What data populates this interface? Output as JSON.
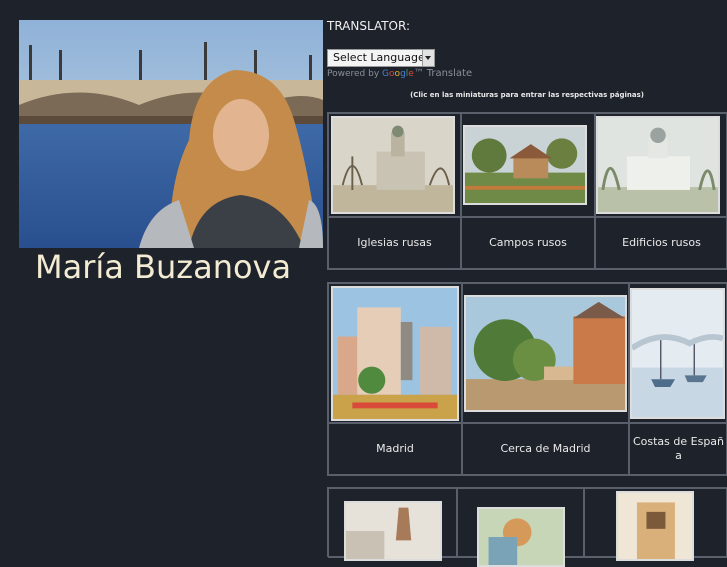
{
  "artist": {
    "name": "María Buzanova"
  },
  "translator": {
    "label": "TRANSLATOR:",
    "select_value": "Select Language",
    "powered_by": "Powered by",
    "google_letters": [
      "G",
      "o",
      "o",
      "g",
      "l",
      "e"
    ],
    "tm": "™",
    "translate": "Translate"
  },
  "hint": "(Clic en las miniaturas para entrar las respectivas páginas)",
  "galleries": {
    "row1": [
      {
        "label": "Iglesias rusas"
      },
      {
        "label": "Campos rusos"
      },
      {
        "label": "Edificios rusos"
      }
    ],
    "row2": [
      {
        "label": "Madrid"
      },
      {
        "label": "Cerca de Madrid"
      },
      {
        "label": "Costas de España"
      }
    ]
  },
  "colors": {
    "background": "#1e222b",
    "name_text": "#f3ecd2",
    "border": "#5a606b"
  }
}
